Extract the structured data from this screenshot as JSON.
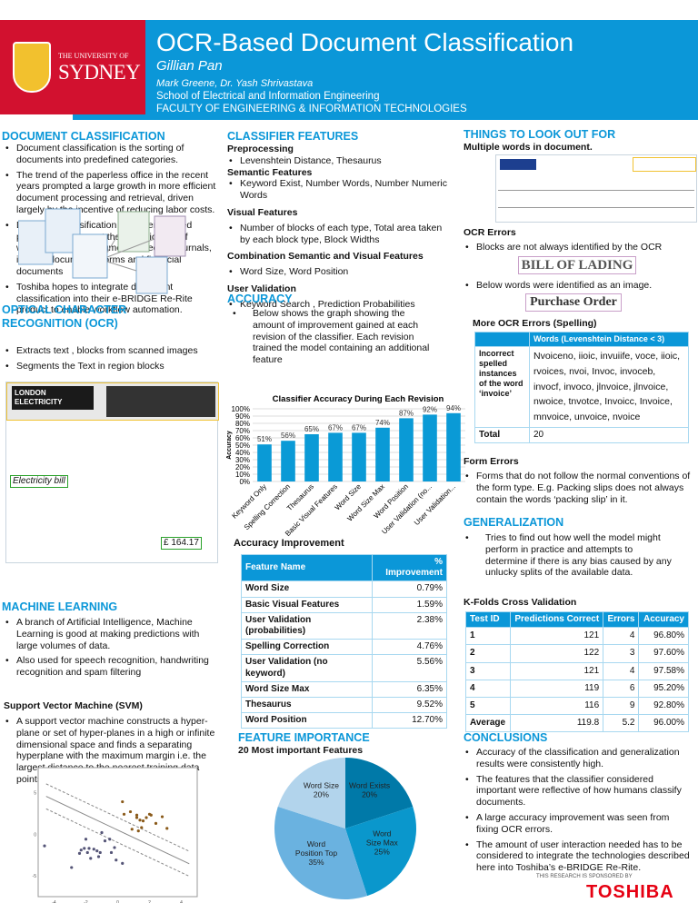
{
  "header": {
    "university_line1": "THE UNIVERSITY OF",
    "university_line2": "SYDNEY",
    "title": "OCR-Based Document Classification",
    "author": "Gillian Pan",
    "coauthors": "Mark Greene, Dr. Yash Shrivastava",
    "school": "School of Electrical and Information Engineering",
    "faculty": "FACULTY OF ENGINEERING & INFORMATION TECHNOLOGIES"
  },
  "doc_class": {
    "heading": "DOCUMENT CLASSIFICATION",
    "bullets": [
      "Document classification is the sorting of documents into predefined categories.",
      "The trend of the paperless office in the recent years prompted a large growth in more efficient document processing and retrieval, driven largely by the incentive of reducing labor costs.",
      "Document classification has been studied previously to support the classification of wartime archival documents, medical journals, identity documents, forms and financial documents",
      "Toshiba hopes to integrate document classification into their e-BRIDGE Re-Rite product to enable workflow automation."
    ]
  },
  "ocr": {
    "heading": "OPTICAL CHARACTER RECOGNITION (OCR)",
    "bullets": [
      "Extracts text , blocks from scanned images",
      "Segments the Text in region blocks"
    ],
    "bill_title": "Electricity bill",
    "bill_brand": "LONDON ELECTRICITY",
    "bill_amount": "£ 164.17"
  },
  "ml": {
    "heading": "MACHINE LEARNING",
    "bullets": [
      "A branch of Artificial Intelligence, Machine Learning is good at making predictions with large volumes of data.",
      "Also used for speech recognition, handwriting recognition and spam filtering"
    ],
    "svm_heading": "Support Vector Machine (SVM)",
    "svm_bullets": [
      "A support vector machine constructs a hyper-plane or set of hyper-planes in a high or infinite dimensional space and finds a separating hyperplane with the maximum margin i.e. the largest distance to the nearest training data points of any class"
    ]
  },
  "features": {
    "heading": "CLASSIFIER FEATURES",
    "pre_h": "Preprocessing",
    "pre_b": "Levenshtein Distance, Thesaurus",
    "sem_h": "Semantic Features",
    "sem_b": "Keyword Exist, Number Words, Number Numeric Words",
    "vis_h": "Visual Features",
    "vis_b": "Number of blocks of each type, Total  area taken by each block type, Block Widths",
    "comb_h": "Combination Semantic and Visual Features",
    "comb_b": "Word Size, Word Position",
    "uv_h": "User Validation",
    "uv_b": "Keyword Search , Prediction Probabilities"
  },
  "accuracy": {
    "heading": "ACCURACY",
    "bullet": "Below shows the graph showing the amount of improvement gained at each revision of the classifier. Each revision trained the model containing an additional feature",
    "table_title": "Accuracy Improvement",
    "table_headers": [
      "Feature Name",
      "% Improvement"
    ],
    "table_rows": [
      [
        "Word Size",
        "0.79%"
      ],
      [
        "Basic Visual Features",
        "1.59%"
      ],
      [
        "User Validation (probabilities)",
        "2.38%"
      ],
      [
        "Spelling Correction",
        "4.76%"
      ],
      [
        "User Validation (no keyword)",
        "5.56%"
      ],
      [
        "Word Size Max",
        "6.35%"
      ],
      [
        "Thesaurus",
        "9.52%"
      ],
      [
        "Word Position",
        "12.70%"
      ]
    ]
  },
  "importance": {
    "heading": "FEATURE IMPORTANCE",
    "subtitle": "20 Most important Features"
  },
  "look_out": {
    "heading": "THINGS TO LOOK OUT FOR",
    "multi": "Multiple words in document.",
    "ocr_errors_h": "OCR Errors",
    "ocr_b1": "Blocks are not always identified by the OCR",
    "bol_text": "BILL OF LADING",
    "ocr_b2": "Below words were identified as an image.",
    "po_text": "Purchase Order",
    "spell_h": "More OCR Errors (Spelling)",
    "spell_header": "Words (Levenshtein Distance < 3)",
    "spell_label": "Incorrect spelled instances of the word ‘invoice’",
    "spell_words": "Nvoiceno, iioic, invuiife, voce, iioic, rvoices, nvoi, Invoc, invoceb, invocf, invoco, jlnvoice, jlnvoice, nwoice, tnvotce, Invoicc, Invoice, mnvoice, unvoice, nvoice",
    "total_label": "Total",
    "total_value": "20",
    "form_h": "Form Errors",
    "form_b": "Forms that do not follow the normal conventions of the form type. E.g. Packing slips does not always contain the words ‘packing slip’ in it."
  },
  "generalization": {
    "heading": "GENERALIZATION",
    "bullet": "Tries to find out how well the model might perform in practice and attempts to determine if there is any bias caused by any unlucky splits of the available data.",
    "kfold_h": "K-Folds Cross Validation",
    "headers": [
      "Test ID",
      "Predictions Correct",
      "Errors",
      "Accuracy"
    ],
    "rows": [
      [
        "1",
        "121",
        "4",
        "96.80%"
      ],
      [
        "2",
        "122",
        "3",
        "97.60%"
      ],
      [
        "3",
        "121",
        "4",
        "97.58%"
      ],
      [
        "4",
        "119",
        "6",
        "95.20%"
      ],
      [
        "5",
        "116",
        "9",
        "92.80%"
      ],
      [
        "Average",
        "119.8",
        "5.2",
        "96.00%"
      ]
    ]
  },
  "conclusions": {
    "heading": "CONCLUSIONS",
    "bullets": [
      "Accuracy of the classification and generalization results were consistently high.",
      "The features that the classifier considered important were reflective of how humans classify documents.",
      "A large accuracy improvement was seen from fixing OCR errors.",
      "The amount of user interaction needed has to be considered to integrate the technologies described here into Toshiba’s e-BRIDGE Re-Rite."
    ],
    "sponsor": "THIS RESEARCH IS SPONSORED BY",
    "sponsor_logo": "TOSHIBA"
  },
  "colors": {
    "accent": "#0b97d8",
    "university_red": "#d2112f",
    "toshiba_red": "#e60012"
  },
  "chart_data": [
    {
      "type": "bar",
      "title": "Classifier Accuracy During Each Revision",
      "ylabel": "Accuracy",
      "xlabel": "",
      "categories": [
        "Keyword Only",
        "Spelling Correction",
        "Thesaurus",
        "Basic Visual Features",
        "Word Size",
        "Word Size Max",
        "Word Position",
        "User Validation (no...",
        "User Validation..."
      ],
      "values": [
        51,
        56,
        65,
        67,
        67,
        74,
        87,
        92,
        94
      ],
      "data_labels": [
        "51%",
        "56%",
        "65%",
        "67%",
        "67%",
        "74%",
        "87%",
        "92%",
        "94%"
      ],
      "ylim": [
        0,
        100
      ],
      "yticks": [
        "0%",
        "10%",
        "20%",
        "30%",
        "40%",
        "50%",
        "60%",
        "70%",
        "80%",
        "90%",
        "100%"
      ],
      "grid": true,
      "color": "#0a9ad6"
    },
    {
      "type": "pie",
      "title": "20 Most important Features",
      "slices": [
        {
          "label": "Word Exists",
          "value": 20,
          "color": "#0079a8"
        },
        {
          "label": "Word Size Max",
          "value": 25,
          "color": "#0a97cc"
        },
        {
          "label": "Word Position Top",
          "value": 35,
          "color": "#6ab2e0"
        },
        {
          "label": "Word Size",
          "value": 20,
          "color": "#b2d4ec"
        }
      ]
    },
    {
      "type": "scatter",
      "xlim": [
        -5,
        5
      ],
      "ylim": [
        -7.5,
        8
      ],
      "xticks": [
        -4,
        -2,
        0,
        2,
        4
      ],
      "yticks": [
        5,
        0,
        -5
      ],
      "grid": false,
      "class_a": [
        [
          0.3,
          3.9
        ],
        [
          0.4,
          2.4
        ],
        [
          0.8,
          2.7
        ],
        [
          1.2,
          2.3
        ],
        [
          1.2,
          2
        ],
        [
          1.4,
          1.7
        ],
        [
          1.6,
          1.6
        ],
        [
          1.5,
          0.8
        ],
        [
          2,
          2.4
        ],
        [
          2.1,
          2.3
        ],
        [
          1.8,
          2
        ],
        [
          2.4,
          1.3
        ],
        [
          2.8,
          2.1
        ],
        [
          3.1,
          0.7
        ],
        [
          0.9,
          0.6
        ],
        [
          1.3,
          0.4
        ]
      ],
      "class_b": [
        [
          -4.6,
          -1.4
        ],
        [
          -2.9,
          -4
        ],
        [
          -2.4,
          -2.3
        ],
        [
          -2.3,
          -1.9
        ],
        [
          -2.1,
          -1.7
        ],
        [
          -1.9,
          -2.2
        ],
        [
          -1.8,
          -1.7
        ],
        [
          -1.7,
          -2.9
        ],
        [
          -1.5,
          -1.8
        ],
        [
          -1.3,
          -2
        ],
        [
          -1.2,
          -2.7
        ],
        [
          -1.1,
          -2.2
        ],
        [
          -1,
          0.2
        ],
        [
          -0.8,
          -0.8
        ],
        [
          -0.5,
          -0.6
        ],
        [
          -0.4,
          -2.2
        ],
        [
          -0.2,
          -1.6
        ],
        [
          -0.1,
          -3.1
        ],
        [
          0.3,
          -3.5
        ],
        [
          -2,
          -0.6
        ]
      ],
      "separator_slope": -0.9,
      "separator_intercept": 0.5,
      "margin": 1.5
    }
  ]
}
